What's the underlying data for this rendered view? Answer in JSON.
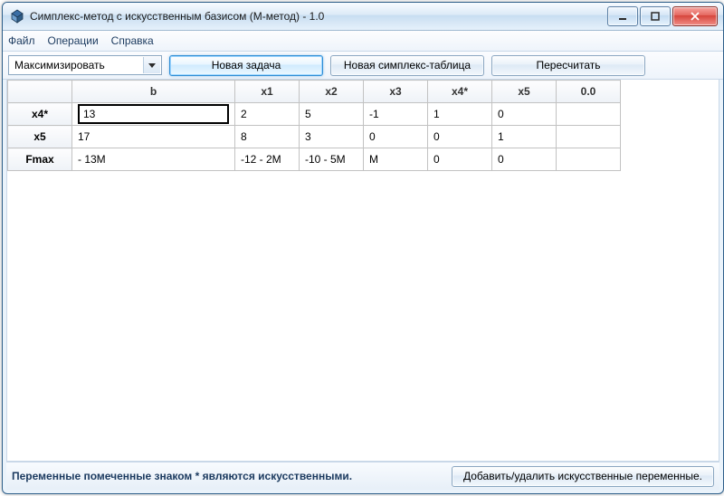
{
  "window": {
    "title": "Симплекс-метод с искусственным базисом (М-метод) - 1.0"
  },
  "menu": {
    "file": "Файл",
    "operations": "Операции",
    "help": "Справка"
  },
  "toolbar": {
    "objective": "Максимизировать",
    "new_task": "Новая задача",
    "new_table": "Новая симплекс-таблица",
    "recalculate": "Пересчитать"
  },
  "table": {
    "columns": [
      "",
      "b",
      "x1",
      "x2",
      "x3",
      "x4*",
      "x5",
      "0.0"
    ],
    "rows": [
      {
        "head": "x4*",
        "cells": [
          "13",
          "2",
          "5",
          "-1",
          "1",
          "0",
          ""
        ]
      },
      {
        "head": "x5",
        "cells": [
          "17",
          "8",
          "3",
          "0",
          "0",
          "1",
          ""
        ]
      },
      {
        "head": "Fmax",
        "cells": [
          "- 13M",
          "-12 - 2M",
          "-10 - 5M",
          "M",
          "0",
          "0",
          ""
        ]
      }
    ],
    "editing": {
      "row": 0,
      "col": 0,
      "value": "13"
    }
  },
  "footer": {
    "note": "Переменные помеченные знаком * являются искусственными.",
    "artificial_button": "Добавить/удалить искусственные переменные."
  }
}
